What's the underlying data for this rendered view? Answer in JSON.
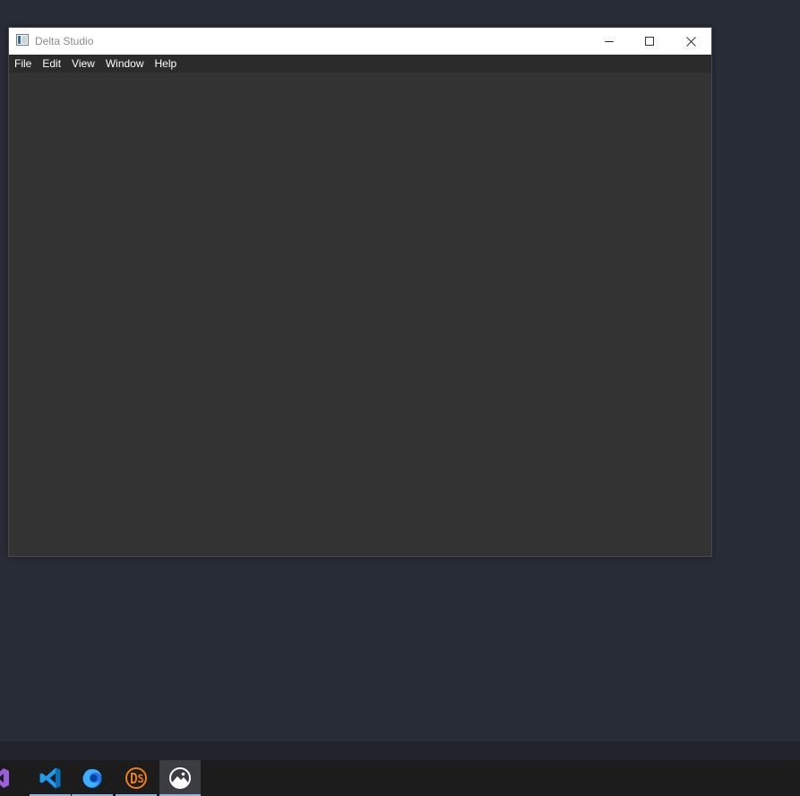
{
  "window": {
    "title": "Delta Studio",
    "icon": "window-app-icon"
  },
  "titlebar_buttons": {
    "minimize": "minimize-icon",
    "maximize": "maximize-icon",
    "close": "close-icon"
  },
  "menu": {
    "items": [
      {
        "label": "File"
      },
      {
        "label": "Edit"
      },
      {
        "label": "View"
      },
      {
        "label": "Window"
      },
      {
        "label": "Help"
      }
    ]
  },
  "taskbar": {
    "apps": [
      {
        "icon": "visual-studio-icon",
        "running": false
      },
      {
        "icon": "vscode-icon",
        "running": true
      },
      {
        "icon": "firefox-icon",
        "running": true
      },
      {
        "icon": "delta-studio-ds-icon",
        "running": true
      },
      {
        "icon": "delta-studio-window-icon",
        "running": true,
        "active": true
      }
    ]
  },
  "colors": {
    "desktop": "#282c37",
    "client_area": "#333333",
    "menu_bar": "#2b2b2b",
    "title_bar": "#ffffff",
    "taskbar": "#1c1c1c",
    "taskbar_indicator": "#8fb3d9",
    "ds_orange": "#f07f1a"
  }
}
